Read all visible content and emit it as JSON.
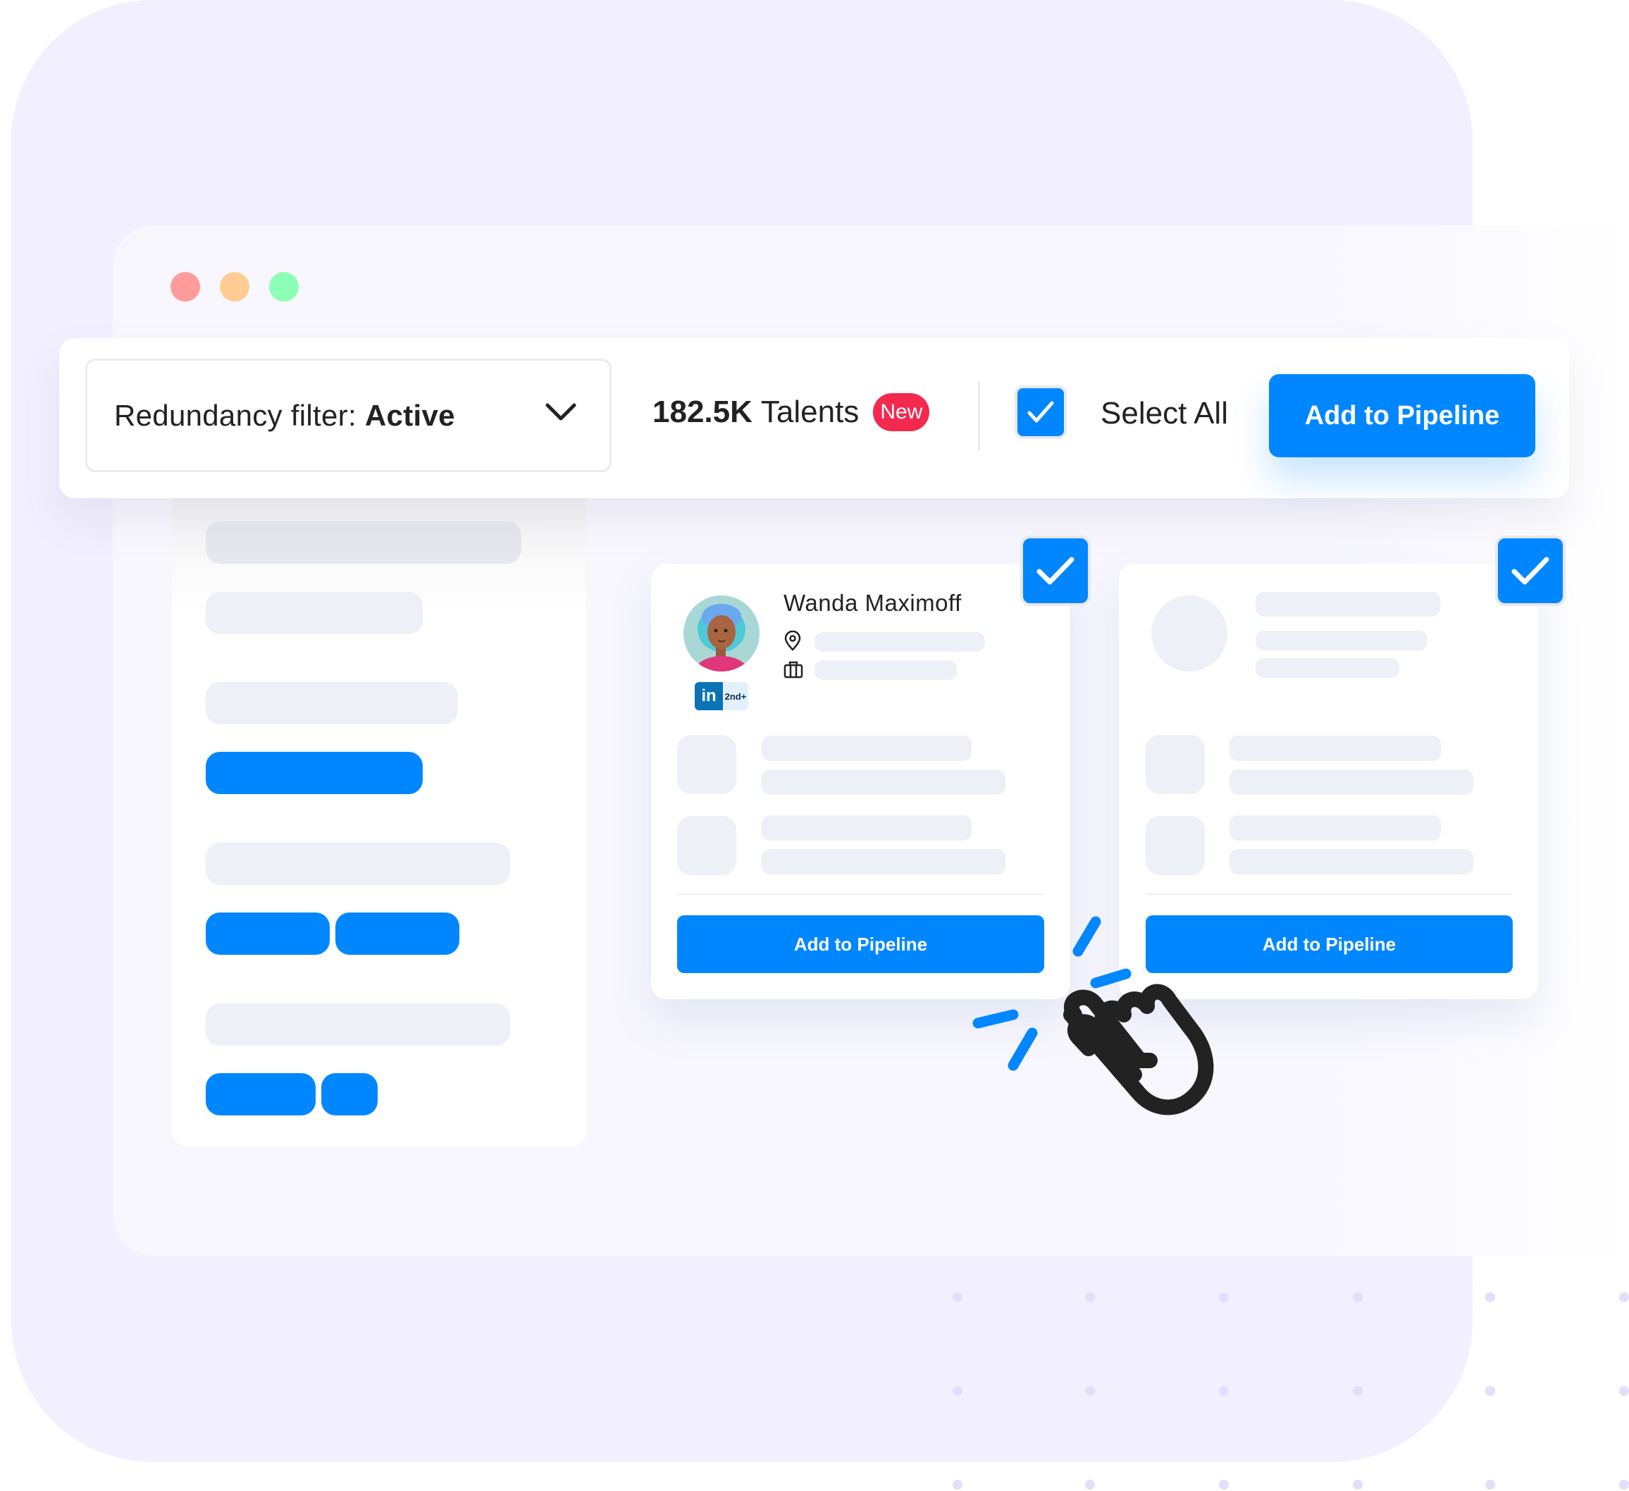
{
  "window": {
    "traffic_lights": [
      {
        "name": "close",
        "color": "#ff9b9b"
      },
      {
        "name": "minimize",
        "color": "#ffcd94"
      },
      {
        "name": "maximize",
        "color": "#8dffb5"
      }
    ]
  },
  "toolbar": {
    "filter_label": "Redundancy filter:",
    "filter_value": "Active",
    "talent_count": "182.5K",
    "talent_label": "Talents",
    "new_badge": "New",
    "select_all_label": "Select All",
    "select_all_checked": true,
    "add_to_pipeline_label": "Add to Pipeline"
  },
  "cards": [
    {
      "name": "Wanda Maximoff",
      "linkedin_label": "in",
      "connection_degree": "2nd+",
      "checked": true,
      "button_label": "Add to Pipeline"
    },
    {
      "name": "",
      "checked": true,
      "button_label": "Add to Pipeline"
    }
  ],
  "colors": {
    "accent": "#0087ff",
    "badge": "#f3294d",
    "background": "#f2f0fe",
    "skeleton": "#edf0f7",
    "linkedin": "#0a73b4"
  }
}
